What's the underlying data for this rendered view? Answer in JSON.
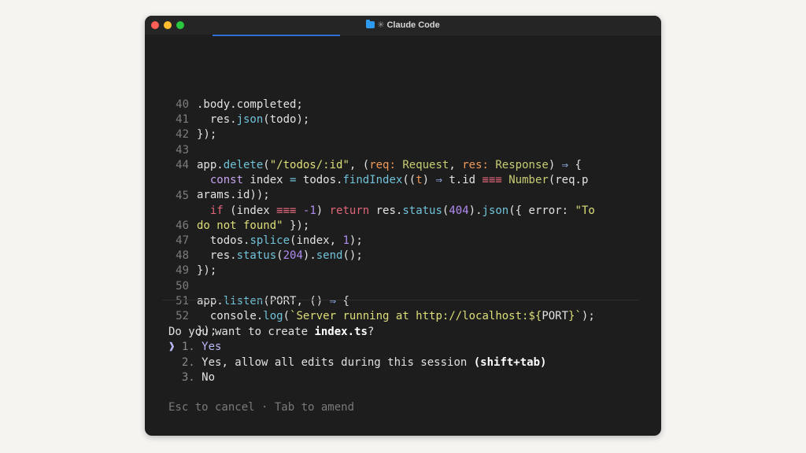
{
  "window": {
    "title": "Claude Code",
    "folder_icon": "folder-icon",
    "spark_icon": "sparkle-icon",
    "spark_glyph": "✳"
  },
  "code": {
    "lines": [
      {
        "num": "",
        "text": ".body.completed;"
      },
      {
        "num": "40",
        "parts": [
          "  res.",
          "json",
          "(todo);"
        ]
      },
      {
        "num": "41",
        "text": "});"
      },
      {
        "num": "42",
        "text": ""
      },
      {
        "num": "43",
        "parts": [
          "app.",
          "delete",
          "(",
          "\"/todos/:id\"",
          ", (",
          "req",
          ": ",
          "Request",
          ", ",
          "res",
          ": ",
          "Response",
          ") ",
          "⇒",
          " {"
        ]
      },
      {
        "num": "44",
        "parts": [
          "  ",
          "const",
          " index ",
          "=",
          " todos.",
          "findIndex",
          "((",
          "t",
          ") ",
          "⇒",
          " t.id ",
          "≡≡≡",
          " ",
          "Number",
          "(req.p"
        ]
      },
      {
        "num": "",
        "text": "arams.id));"
      },
      {
        "num": "45",
        "parts": [
          "  ",
          "if",
          " (index ",
          "≡≡≡",
          " ",
          "-1",
          ") ",
          "return",
          " res.",
          "status",
          "(",
          "404",
          ").",
          "json",
          "({ error: ",
          "\"To"
        ]
      },
      {
        "num": "",
        "parts": [
          "do not found\"",
          " });"
        ]
      },
      {
        "num": "46",
        "parts": [
          "  todos.",
          "splice",
          "(index, ",
          "1",
          ");"
        ]
      },
      {
        "num": "47",
        "parts": [
          "  res.",
          "status",
          "(",
          "204",
          ").",
          "send",
          "();"
        ]
      },
      {
        "num": "48",
        "text": "});"
      },
      {
        "num": "49",
        "text": ""
      },
      {
        "num": "50",
        "parts": [
          "app.",
          "listen",
          "(PORT, () ",
          "⇒",
          " {"
        ]
      },
      {
        "num": "51",
        "parts": [
          "  console.",
          "log",
          "(",
          "`Server running at http://localhost:${",
          "PORT",
          "}`",
          ");"
        ]
      },
      {
        "num": "52",
        "text": "});"
      }
    ]
  },
  "prompt": {
    "question_prefix": "Do you want to create ",
    "question_file": "index.ts",
    "question_suffix": "?",
    "cursor": "❱",
    "options": [
      {
        "num": "1.",
        "label": "Yes",
        "hint": ""
      },
      {
        "num": "2.",
        "label": "Yes, allow all edits during this session ",
        "hint": "(shift+tab)"
      },
      {
        "num": "3.",
        "label": "No",
        "hint": ""
      }
    ],
    "footer": "Esc to cancel · Tab to amend"
  }
}
